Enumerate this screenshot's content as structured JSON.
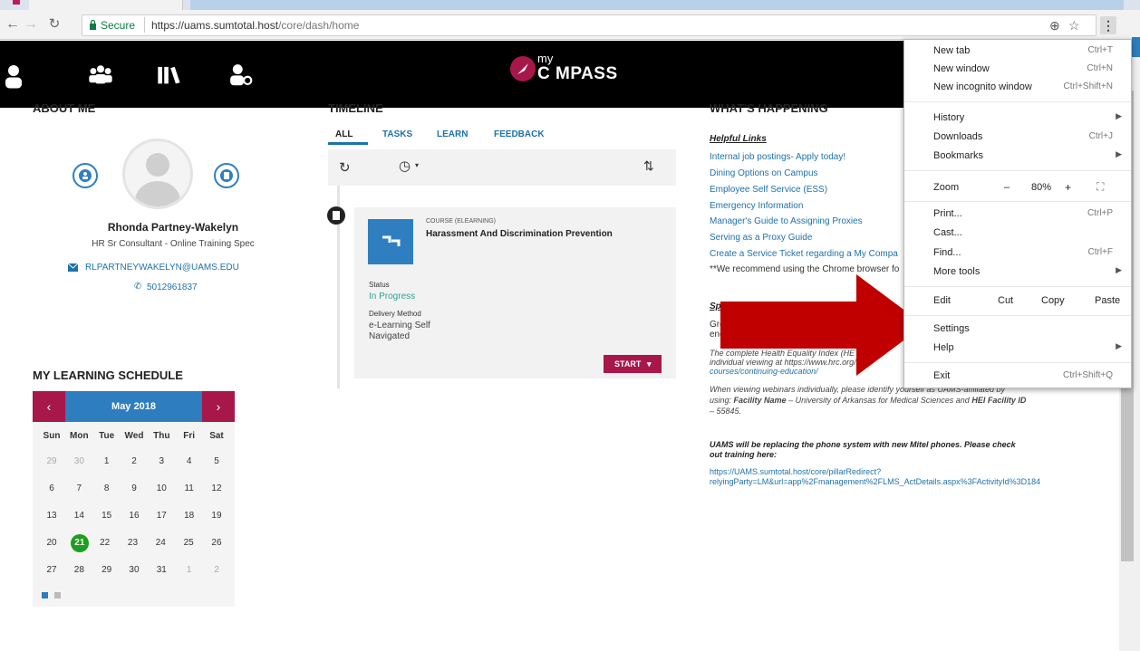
{
  "browser": {
    "secure_label": "Secure",
    "url_host": "https://uams.sumtotal.host",
    "url_path": "/core/dash/home"
  },
  "app": {
    "logo_small": "my",
    "logo_big": "C MPASS"
  },
  "about": {
    "title": "ABOUT ME",
    "name": "Rhonda Partney-Wakelyn",
    "job": "HR Sr Consultant - Online Training Spec",
    "email": "RLPARTNEYWAKELYN@UAMS.EDU",
    "phone": "5012961837"
  },
  "schedule": {
    "title": "MY LEARNING SCHEDULE",
    "month": "May 2018",
    "prev": "‹",
    "next": "›",
    "daynames": [
      "Sun",
      "Mon",
      "Tue",
      "Wed",
      "Thu",
      "Fri",
      "Sat"
    ],
    "weeks": [
      [
        "29",
        "30",
        "1",
        "2",
        "3",
        "4",
        "5"
      ],
      [
        "6",
        "7",
        "8",
        "9",
        "10",
        "11",
        "12"
      ],
      [
        "13",
        "14",
        "15",
        "16",
        "17",
        "18",
        "19"
      ],
      [
        "20",
        "21",
        "22",
        "23",
        "24",
        "25",
        "26"
      ],
      [
        "27",
        "28",
        "29",
        "30",
        "31",
        "1",
        "2"
      ]
    ]
  },
  "timeline": {
    "title": "TIMELINE",
    "tabs": [
      "ALL",
      "TASKS",
      "LEARN",
      "FEEDBACK"
    ],
    "card": {
      "type": "COURSE (ELEARNING)",
      "title": "Harassment And Discrimination Prevention",
      "status_label": "Status",
      "status_value": "In Progress",
      "delivery_label": "Delivery Method",
      "delivery_value_1": "e-Learning Self",
      "delivery_value_2": "Navigated",
      "start_label": "START"
    }
  },
  "happening": {
    "title": "WHAT'S HAPPENING",
    "heading": "Helpful Links",
    "links": [
      "Internal job postings- Apply today!",
      "Dining Options on Campus",
      "Employee Self Service (ESS)",
      "Emergency Information",
      "Manager's Guide to Assigning Proxies",
      "Serving as a Proxy Guide",
      "Create a Service Ticket regarding a My Compa"
    ],
    "note": "**We recommend using the Chrome browser fo",
    "special_heading": "Spec",
    "group_line_1": "Group",
    "group_line_2": "encou",
    "hei_1": "The complete Health Equality Index (HE",
    "hei_1b": "edu",
    "hei_2": "individual viewing at https://www.hrc.org/hei",
    "hei_3": "courses/continuing-education/",
    "webinar_1": "When viewing webinars individually, please identify yourself as UAMS-affiliated by",
    "webinar_2a": "using: ",
    "webinar_2b": "Facility Name",
    "webinar_2c": " – University of Arkansas for Medical Sciences and ",
    "webinar_2d": "HEI Facility ID",
    "webinar_3": "– 55845.",
    "phone_1": "UAMS will be replacing the phone system with new Mitel phones. Please check",
    "phone_2": "out training here:",
    "phone_link_1": "https://UAMS.sumtotal.host/core/pillarRedirect?",
    "phone_link_2": "relyingParty=LM&url=app%2Fmanagement%2FLMS_ActDetails.aspx%3FActivityId%3D184"
  },
  "menu": {
    "new_tab": "New tab",
    "new_tab_sc": "Ctrl+T",
    "new_window": "New window",
    "new_window_sc": "Ctrl+N",
    "incognito": "New incognito window",
    "incognito_sc": "Ctrl+Shift+N",
    "history": "History",
    "downloads": "Downloads",
    "downloads_sc": "Ctrl+J",
    "bookmarks": "Bookmarks",
    "zoom": "Zoom",
    "zoom_minus": "–",
    "zoom_value": "80%",
    "zoom_plus": "+",
    "print": "Print...",
    "print_sc": "Ctrl+P",
    "cast": "Cast...",
    "find": "Find...",
    "find_sc": "Ctrl+F",
    "more_tools": "More tools",
    "edit": "Edit",
    "cut": "Cut",
    "copy": "Copy",
    "paste": "Paste",
    "settings": "Settings",
    "help": "Help",
    "exit": "Exit",
    "exit_sc": "Ctrl+Shift+Q"
  },
  "colors": {
    "accent_blue": "#2d7dbf",
    "brand_red": "#a8174a",
    "arrow_red": "#c00000",
    "today_green": "#1e9e1e"
  }
}
